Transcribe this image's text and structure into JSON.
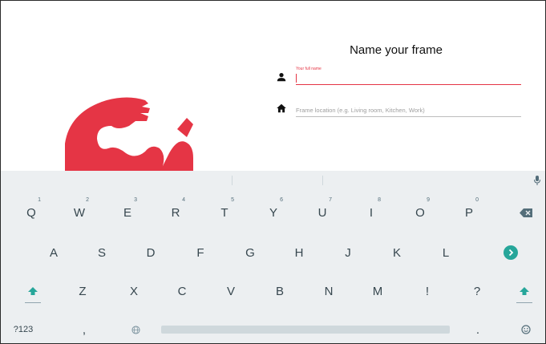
{
  "dialog": {
    "title": "Name your frame",
    "name_field": {
      "label": "Your full name",
      "value": "",
      "icon": "person-icon"
    },
    "location_field": {
      "placeholder": "Frame location (e.g. Living room, Kitchen, Work)",
      "icon": "home-icon"
    }
  },
  "colors": {
    "accent": "#e53545",
    "keyboard_bg": "#eceff1",
    "key_text": "#37474f",
    "action_teal": "#26a69a"
  },
  "keyboard": {
    "row1": [
      {
        "key": "Q",
        "hint": "1"
      },
      {
        "key": "W",
        "hint": "2"
      },
      {
        "key": "E",
        "hint": "3"
      },
      {
        "key": "R",
        "hint": "4"
      },
      {
        "key": "T",
        "hint": "5"
      },
      {
        "key": "Y",
        "hint": "6"
      },
      {
        "key": "U",
        "hint": "7"
      },
      {
        "key": "I",
        "hint": "8"
      },
      {
        "key": "O",
        "hint": "9"
      },
      {
        "key": "P",
        "hint": "0"
      }
    ],
    "row2": [
      "A",
      "S",
      "D",
      "F",
      "G",
      "H",
      "J",
      "K",
      "L"
    ],
    "row3": [
      "Z",
      "X",
      "C",
      "V",
      "B",
      "N",
      "M",
      "!",
      "?"
    ],
    "bottom": {
      "symbols": "?123",
      "comma": ",",
      "period": "."
    },
    "icons": {
      "backspace": "backspace-icon",
      "enter": "next-arrow-icon",
      "shift": "shift-icon",
      "globe": "globe-icon",
      "emoji": "emoji-icon",
      "mic": "mic-icon"
    }
  }
}
